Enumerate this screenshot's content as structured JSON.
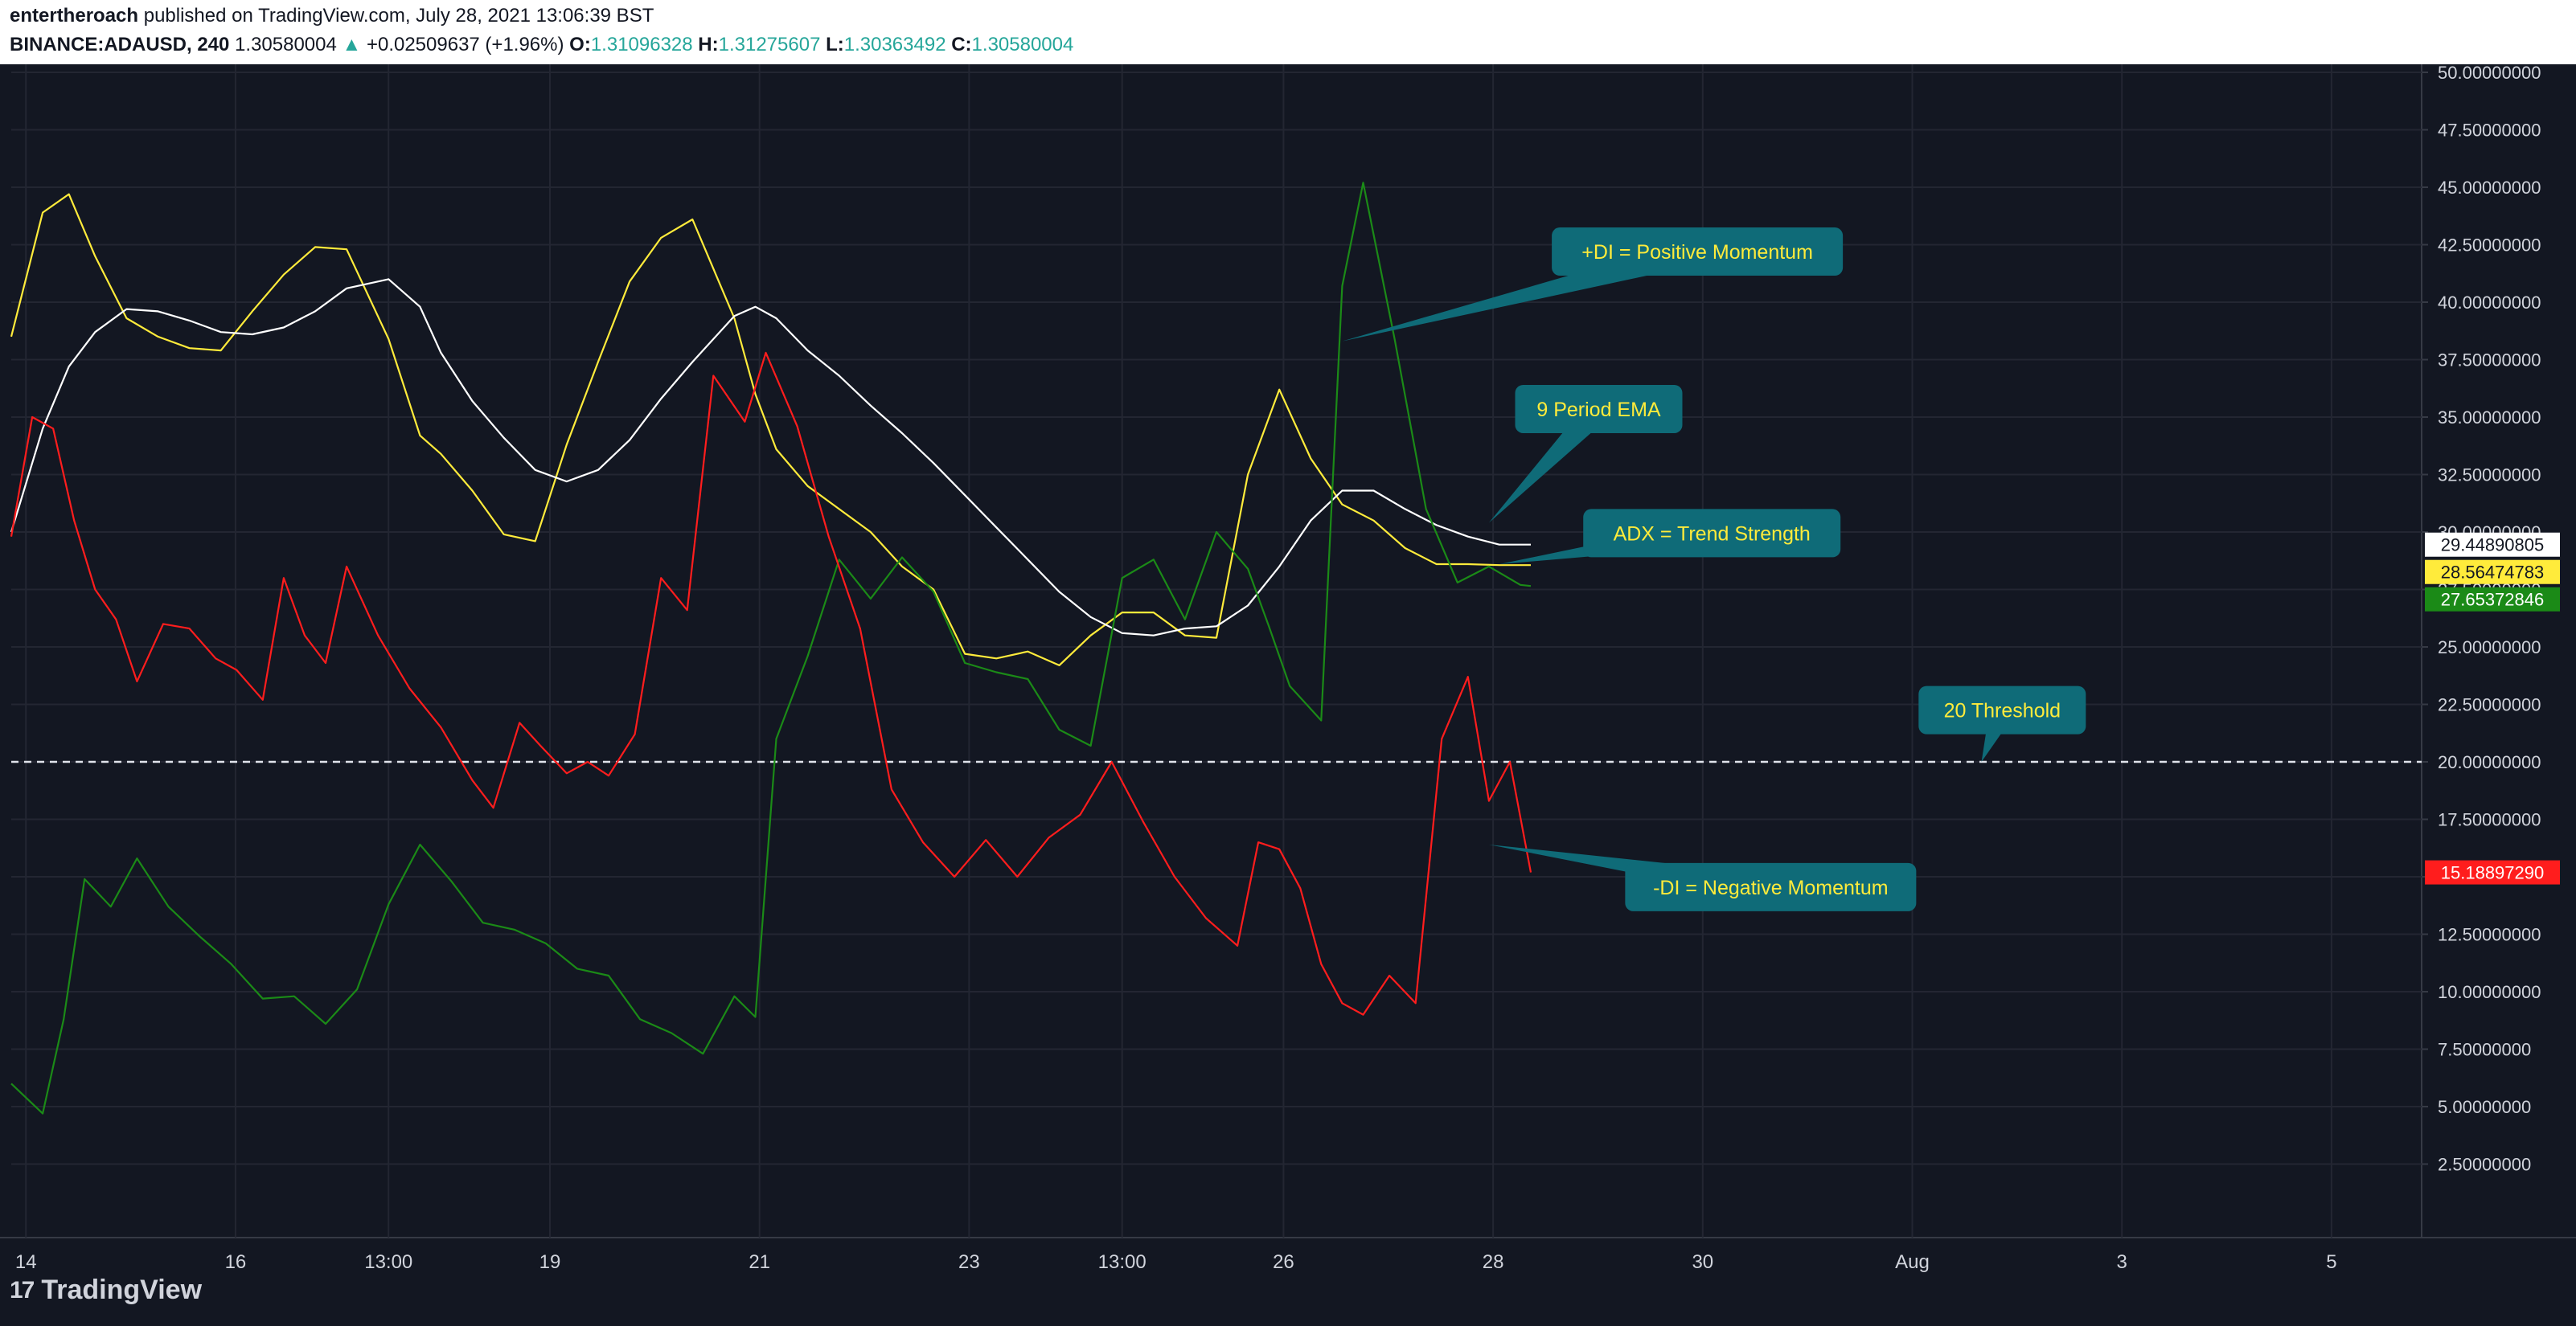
{
  "header": {
    "author": "entertheroach",
    "published": "published on TradingView.com, July 28, 2021 13:06:39 BST",
    "symbol": "BINANCE:ADAUSD, 240",
    "price": "1.30580004",
    "change": "+0.02509637 (+1.96%)",
    "o_label": "O:",
    "o_value": "1.31096328",
    "h_label": "H:",
    "h_value": "1.31275607",
    "l_label": "L:",
    "l_value": "1.30363492",
    "c_label": "C:",
    "c_value": "1.30580004"
  },
  "footer": {
    "brand": "TradingView",
    "logo_icon": "tradingview-logo-icon"
  },
  "chart_data": {
    "type": "line",
    "ylim": [
      0,
      50
    ],
    "yticks": [
      "50.00000000",
      "47.50000000",
      "45.00000000",
      "42.50000000",
      "40.00000000",
      "37.50000000",
      "35.00000000",
      "32.50000000",
      "30.00000000",
      "27.50000000",
      "25.00000000",
      "22.50000000",
      "20.00000000",
      "17.50000000",
      "15.00000000",
      "12.50000000",
      "10.00000000",
      "7.50000000",
      "5.00000000",
      "2.50000000"
    ],
    "ytick_values": [
      50,
      47.5,
      45,
      42.5,
      40,
      37.5,
      35,
      32.5,
      30,
      27.5,
      25,
      22.5,
      20,
      17.5,
      15,
      12.5,
      10,
      7.5,
      5,
      2.5
    ],
    "xticks": [
      "14",
      "16",
      "13:00",
      "19",
      "21",
      "23",
      "13:00",
      "26",
      "28",
      "30",
      "Aug",
      "3",
      "5"
    ],
    "xtick_positions": [
      0.14,
      2.14,
      3.6,
      5.14,
      7.14,
      9.14,
      10.6,
      12.14,
      14.14,
      16.14,
      18.14,
      20.14,
      22.14
    ],
    "x_range": [
      0.0,
      23.0
    ],
    "threshold": 20,
    "series": [
      {
        "name": "ADX",
        "color": "#ffeb3b",
        "x": [
          0.0,
          0.3,
          0.55,
          0.8,
          1.1,
          1.4,
          1.7,
          2.0,
          2.3,
          2.6,
          2.9,
          3.2,
          3.6,
          3.9,
          4.1,
          4.4,
          4.7,
          5.0,
          5.3,
          5.6,
          5.9,
          6.2,
          6.5,
          6.9,
          7.1,
          7.3,
          7.6,
          7.9,
          8.2,
          8.5,
          8.8,
          9.1,
          9.4,
          9.7,
          10.0,
          10.3,
          10.6,
          10.9,
          11.2,
          11.5,
          11.8,
          12.1,
          12.4,
          12.7,
          13.0,
          13.3,
          13.6,
          13.9,
          14.2,
          14.5
        ],
        "y": [
          38.5,
          43.9,
          44.7,
          42.0,
          39.3,
          38.5,
          38.0,
          37.9,
          39.6,
          41.2,
          42.4,
          42.3,
          38.4,
          34.2,
          33.4,
          31.8,
          29.9,
          29.6,
          33.8,
          37.4,
          40.9,
          42.8,
          43.6,
          39.3,
          36.0,
          33.6,
          32.0,
          31.0,
          30.0,
          28.5,
          27.5,
          24.7,
          24.5,
          24.8,
          24.2,
          25.5,
          26.5,
          26.5,
          25.5,
          25.4,
          32.5,
          36.2,
          33.2,
          31.2,
          30.5,
          29.3,
          28.6,
          28.6,
          28.56,
          28.56
        ]
      },
      {
        "name": "EMA",
        "color": "#ffffff",
        "x": [
          0.0,
          0.3,
          0.55,
          0.8,
          1.1,
          1.4,
          1.7,
          2.0,
          2.3,
          2.6,
          2.9,
          3.2,
          3.6,
          3.9,
          4.1,
          4.4,
          4.7,
          5.0,
          5.3,
          5.6,
          5.9,
          6.2,
          6.5,
          6.9,
          7.1,
          7.3,
          7.6,
          7.9,
          8.2,
          8.5,
          8.8,
          9.1,
          9.4,
          9.7,
          10.0,
          10.3,
          10.6,
          10.9,
          11.2,
          11.5,
          11.8,
          12.1,
          12.4,
          12.7,
          13.0,
          13.3,
          13.6,
          13.9,
          14.2,
          14.5
        ],
        "y": [
          30.0,
          34.5,
          37.2,
          38.7,
          39.7,
          39.6,
          39.2,
          38.7,
          38.6,
          38.9,
          39.6,
          40.6,
          41.0,
          39.8,
          37.8,
          35.7,
          34.1,
          32.7,
          32.2,
          32.7,
          34.0,
          35.8,
          37.4,
          39.4,
          39.8,
          39.3,
          37.9,
          36.8,
          35.5,
          34.3,
          33.0,
          31.6,
          30.2,
          28.8,
          27.4,
          26.3,
          25.6,
          25.5,
          25.8,
          25.9,
          26.8,
          28.5,
          30.5,
          31.8,
          31.8,
          31.0,
          30.3,
          29.8,
          29.45,
          29.45
        ]
      },
      {
        "name": "+DI",
        "color": "#1b8a17",
        "x": [
          0.0,
          0.3,
          0.5,
          0.7,
          0.95,
          1.2,
          1.5,
          1.8,
          2.1,
          2.4,
          2.7,
          3.0,
          3.3,
          3.6,
          3.9,
          4.2,
          4.5,
          4.8,
          5.1,
          5.4,
          5.7,
          6.0,
          6.3,
          6.6,
          6.9,
          7.1,
          7.3,
          7.6,
          7.9,
          8.2,
          8.5,
          8.8,
          9.1,
          9.4,
          9.7,
          10.0,
          10.3,
          10.6,
          10.9,
          11.2,
          11.5,
          11.8,
          12.0,
          12.2,
          12.5,
          12.7,
          12.9,
          13.2,
          13.5,
          13.8,
          14.1,
          14.4,
          14.5
        ],
        "y": [
          6.0,
          4.7,
          8.8,
          14.9,
          13.7,
          15.8,
          13.7,
          12.4,
          11.2,
          9.7,
          9.8,
          8.6,
          10.1,
          13.8,
          16.4,
          14.8,
          13.0,
          12.7,
          12.1,
          11.0,
          10.7,
          8.8,
          8.2,
          7.3,
          9.8,
          8.9,
          21.0,
          24.6,
          28.8,
          27.1,
          28.9,
          27.4,
          24.3,
          23.9,
          23.6,
          21.4,
          20.7,
          28.0,
          28.8,
          26.2,
          30.0,
          28.4,
          25.9,
          23.3,
          21.8,
          40.7,
          45.2,
          38.4,
          31.0,
          27.8,
          28.5,
          27.7,
          27.65
        ]
      },
      {
        "name": "-DI",
        "color": "#ff1d1d",
        "x": [
          0.0,
          0.2,
          0.4,
          0.6,
          0.8,
          1.0,
          1.2,
          1.45,
          1.7,
          1.95,
          2.15,
          2.4,
          2.6,
          2.8,
          3.0,
          3.2,
          3.5,
          3.8,
          4.1,
          4.4,
          4.6,
          4.85,
          5.05,
          5.3,
          5.5,
          5.7,
          5.95,
          6.2,
          6.45,
          6.7,
          7.0,
          7.2,
          7.5,
          7.8,
          8.1,
          8.4,
          8.7,
          9.0,
          9.3,
          9.6,
          9.9,
          10.2,
          10.5,
          10.8,
          11.1,
          11.4,
          11.7,
          11.9,
          12.1,
          12.3,
          12.5,
          12.7,
          12.9,
          13.15,
          13.4,
          13.65,
          13.9,
          14.1,
          14.3,
          14.5
        ],
        "y": [
          29.8,
          35.0,
          34.5,
          30.5,
          27.5,
          26.2,
          23.5,
          26.0,
          25.8,
          24.5,
          24.0,
          22.7,
          28.0,
          25.5,
          24.3,
          28.5,
          25.5,
          23.2,
          21.5,
          19.2,
          18.0,
          21.7,
          20.7,
          19.5,
          20.0,
          19.4,
          21.2,
          28.0,
          26.6,
          36.8,
          34.8,
          37.8,
          34.6,
          29.8,
          25.8,
          18.8,
          16.5,
          15.0,
          16.6,
          15.0,
          16.7,
          17.7,
          20.0,
          17.4,
          15.0,
          13.2,
          12.0,
          16.5,
          16.2,
          14.5,
          11.2,
          9.5,
          9.0,
          10.7,
          9.5,
          21.0,
          23.7,
          18.3,
          20.0,
          15.19
        ]
      }
    ],
    "last_values": [
      {
        "label": "29.44890805",
        "color": "#ffffff",
        "text_color": "#131722",
        "y": 29.45
      },
      {
        "label": "28.56474783",
        "color": "#ffeb3b",
        "text_color": "#131722",
        "y": 28.56
      },
      {
        "label": "27.65372846",
        "color": "#1b8a17",
        "text_color": "#ffffff",
        "y": 27.65
      },
      {
        "label": "15.18897290",
        "color": "#ff1d1d",
        "text_color": "#ffffff",
        "y": 15.19
      }
    ],
    "annotations": [
      {
        "text": "+DI = Positive Momentum",
        "box_x": 14.7,
        "box_y": 43.25,
        "tip_x": 12.7,
        "tip_y": 38.3
      },
      {
        "text": "9 Period EMA",
        "box_x": 14.35,
        "box_y": 36.4,
        "tip_x": 14.1,
        "tip_y": 30.4
      },
      {
        "text": "ADX = Trend Strength",
        "box_x": 15.0,
        "box_y": 31.0,
        "tip_x": 14.2,
        "tip_y": 28.6
      },
      {
        "text": "20 Threshold",
        "box_x": 18.2,
        "box_y": 23.3,
        "tip_x": 18.8,
        "tip_y": 20.0
      },
      {
        "text": "-DI = Negative Momentum",
        "box_x": 15.4,
        "box_y": 15.6,
        "tip_x": 14.1,
        "tip_y": 16.4
      }
    ],
    "colors": {
      "background": "#131722",
      "grid": "#232632",
      "axis_text": "#d1d4dc",
      "annotation_fill": "#0f6b78",
      "annotation_text": "#ffeb3b",
      "threshold": "#e0e3eb"
    }
  }
}
